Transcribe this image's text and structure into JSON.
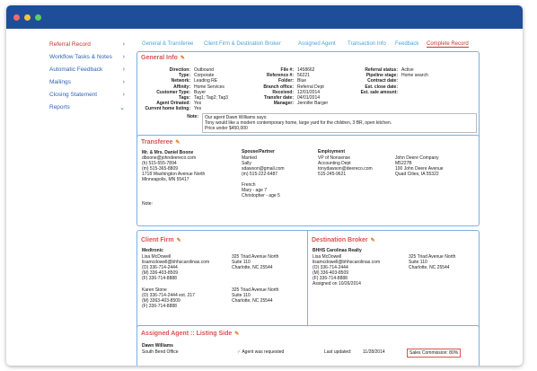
{
  "sidebar": {
    "items": [
      {
        "label": "Referral Record"
      },
      {
        "label": "Workflow Tasks & Notes"
      },
      {
        "label": "Automatic Feedback"
      },
      {
        "label": "Mailings"
      },
      {
        "label": "Closing Statement"
      },
      {
        "label": "Reports"
      }
    ]
  },
  "tabs": [
    {
      "label": "General & Transferee"
    },
    {
      "label": "Client Firm & Destination Broker"
    },
    {
      "label": "Assigned Agent"
    },
    {
      "label": "Transaction Info"
    },
    {
      "label": "Feedback"
    },
    {
      "label": "Complete Record"
    }
  ],
  "general": {
    "title": "General Info",
    "col1": [
      {
        "label": "Direction:",
        "value": "Outbound"
      },
      {
        "label": "Type:",
        "value": "Corporate"
      },
      {
        "label": "Network:",
        "value": "Leading RE"
      },
      {
        "label": "Affinity:",
        "value": "Home Services"
      },
      {
        "label": "Customer Type:",
        "value": "Buyer"
      },
      {
        "label": "Tags:",
        "value": "Tag1; Tag2; Tag3"
      },
      {
        "label": "Agent Orinated:",
        "value": "Yes"
      },
      {
        "label": "Current home listing:",
        "value": "Yes"
      }
    ],
    "col2": [
      {
        "label": "File #:",
        "value": "1458662"
      },
      {
        "label": "Reference #:",
        "value": "56221"
      },
      {
        "label": "Folder:",
        "value": "Blue"
      },
      {
        "label": "Branch office:",
        "value": "Referral Dept"
      },
      {
        "label": "Received:",
        "value": "12/01/2014"
      },
      {
        "label": "Transfer date:",
        "value": "04/01/2014"
      },
      {
        "label": "Manager:",
        "value": "Jennifer Barger"
      }
    ],
    "col3": [
      {
        "label": "Referral status:",
        "value": "Active"
      },
      {
        "label": "Pipeline stage:",
        "value": "Home search"
      },
      {
        "label": "Contract date:",
        "value": ""
      },
      {
        "label": "Est. close date:",
        "value": ""
      },
      {
        "label": "Est. sale amount:",
        "value": ""
      }
    ],
    "note_label": "Note:",
    "note_lines": [
      "Our agent Dawn Williams says:",
      "Tony would like a modern contemporary home, large yard for the children, 3 BR, open kitchen.",
      "Price under $450,000"
    ]
  },
  "transferee": {
    "title": "Transferee",
    "name": "Mr. & Mrs. Daniel Boone",
    "contact": [
      "dboone@johndeereco.com",
      "(h)  515-555-7894",
      "(m)  515-365-8809",
      "1718 Washington Avenue North",
      "Minneapolis, MN  55417"
    ],
    "spouse_title": "Spouse/Partner",
    "spouse": [
      "Married",
      "Sally",
      "sdawson@gmail.com",
      "(m)  515-222-6487",
      "",
      "French",
      "Mary - age 7",
      "Christopher - age 5"
    ],
    "employment_title": "Employment",
    "employment": [
      "VP of Nonsense",
      "Accounting Dept",
      "tonydawson@deereco.com",
      "515-245-9621"
    ],
    "employer": [
      "John Deere Company",
      "M5227B",
      "100 John Deere Avenue",
      "Quad Cities, IA  55322"
    ],
    "note_label": "Note:"
  },
  "client_firm": {
    "title": "Client Firm",
    "firm": "Medtronic",
    "contact1": [
      "Lisa McDowell",
      "lisamcdowell@bhhscarolinas.com",
      "(O)  336-714-2444",
      "(M)  336-403-8509",
      "(F)  336-714-8888"
    ],
    "address1": [
      "325 Triad Avenue North",
      "Suite 110",
      "Charlotte, NC  25544"
    ],
    "contact2": [
      "Karen Stone",
      "(O)  336-714-2444 ext. 217",
      "(M)  3363-403-8509",
      "(F)  336-714-8888"
    ],
    "address2": [
      "325 Triad Avenue North",
      "Suite 110",
      "Charlotte, NC  25544"
    ]
  },
  "destination_broker": {
    "title": "Destination Broker",
    "firm": "BHHS Carolinas Realty",
    "contact": [
      "Lisa McDowell",
      "lisamcdowell@bhhscarolinas.com",
      "(O)  336-714-2444",
      "(M)  336-403-8509",
      "(F)  336-714-8888"
    ],
    "address": [
      "325 Triad Avenue North",
      "Suite 110",
      "Charlotte, NC  25544"
    ],
    "assigned": "Assigned on 10/26/2014"
  },
  "assigned_agent": {
    "title": "Assigned Agent :: Listing Side",
    "name": "Dawn Williams",
    "office": "South Bend Office",
    "requested": "Agent was requested",
    "last_updated_label": "Last updated:",
    "last_updated": "11/28/2014",
    "commission": "Sales Commission:  80%"
  },
  "colors": {
    "titlebar": "#1e4e9a",
    "accent_red": "#d9534f",
    "link_blue": "#2f64b4",
    "tab_blue": "#4aa3d9",
    "panel_border": "#7ab0e0"
  }
}
